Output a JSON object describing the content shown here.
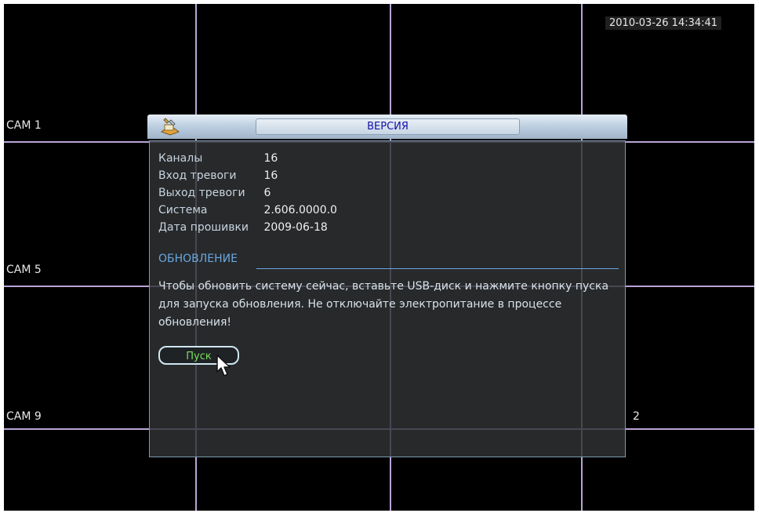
{
  "screen": {
    "timestamp": "2010-03-26 14:34:41",
    "camera_labels": [
      "CAM 1",
      "CAM 5",
      "CAM 9"
    ],
    "right_fragment": "2"
  },
  "dialog": {
    "title": "ВЕРСИЯ",
    "info_rows": [
      {
        "label": "Каналы",
        "value": "16"
      },
      {
        "label": "Вход тревоги",
        "value": "16"
      },
      {
        "label": "Выход тревоги",
        "value": "6"
      },
      {
        "label": "Система",
        "value": "2.606.0000.0"
      },
      {
        "label": "Дата прошивки",
        "value": "2009-06-18"
      }
    ],
    "update_section_title": "ОБНОВЛЕНИЕ",
    "update_text": "Чтобы обновить систему сейчас, вставьте USB-диск и нажмите кнопку пуска для запуска обновления. Не отключайте электропитание в процессе обновления!",
    "start_button_label": "Пуск"
  },
  "colors": {
    "screen_background": "#000000",
    "grid": "#b9a4d6",
    "title_text": "#1010a8",
    "section_accent": "#6aa8e0",
    "button_text": "#7ddf5a"
  },
  "icons": {
    "dialog_icon": "settings-wrench-icon",
    "cursor": "mouse-pointer-icon"
  }
}
